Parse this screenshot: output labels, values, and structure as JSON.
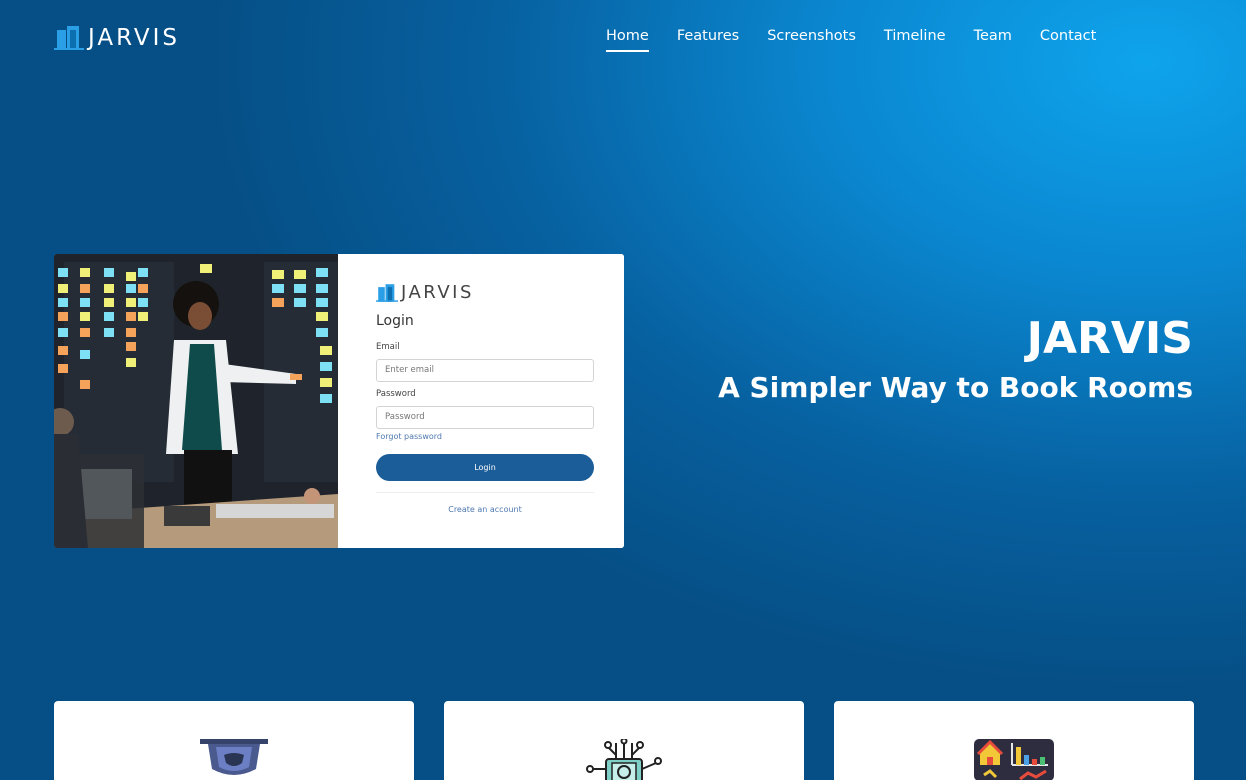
{
  "brand": {
    "name": "JARVIS",
    "logo_icon": "door-icon"
  },
  "nav": {
    "items": [
      {
        "label": "Home",
        "active": true
      },
      {
        "label": "Features",
        "active": false
      },
      {
        "label": "Screenshots",
        "active": false
      },
      {
        "label": "Timeline",
        "active": false
      },
      {
        "label": "Team",
        "active": false
      },
      {
        "label": "Contact",
        "active": false
      }
    ]
  },
  "hero": {
    "title": "JARVIS",
    "subtitle": "A Simpler Way to Book Rooms",
    "screenshot": {
      "brand": "JARVIS",
      "heading": "Login",
      "email_label": "Email",
      "email_placeholder": "Enter email",
      "password_label": "Password",
      "password_placeholder": "Password",
      "forgot_link": "Forgot password",
      "login_button": "Login",
      "create_account_link": "Create an account"
    }
  },
  "features": [
    {
      "icon": "shield-icon"
    },
    {
      "icon": "circuit-brain-icon"
    },
    {
      "icon": "dashboard-chart-icon"
    }
  ],
  "colors": {
    "accent": "#1b5d98",
    "link": "#4e78b0",
    "background_dark": "#064f86",
    "background_light": "#0ea4ec"
  }
}
